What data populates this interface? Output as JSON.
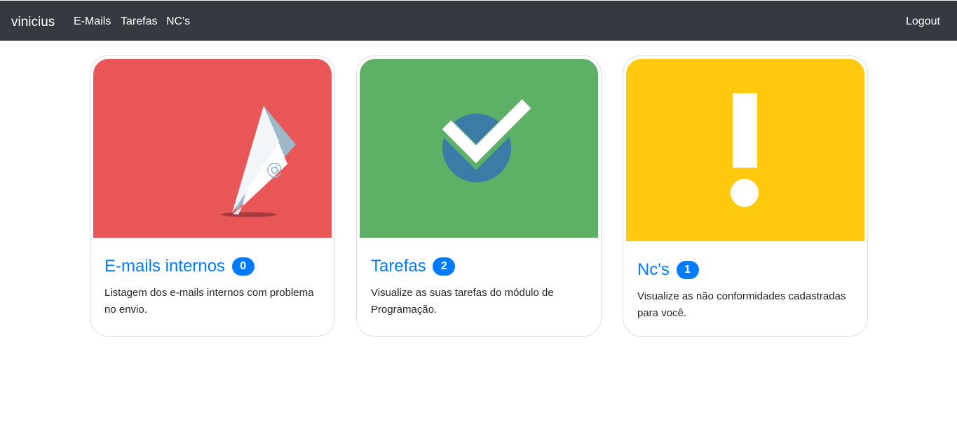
{
  "navbar": {
    "brand": "vinicius",
    "links": [
      "E-Mails",
      "Tarefas",
      "NC's"
    ],
    "logout": "Logout"
  },
  "cards": [
    {
      "icon": "paper-plane-email-icon",
      "bg_color": "#e95658",
      "title": "E-mails internos",
      "badge": "0",
      "text": "Listagem dos e-mails internos com problema no envio."
    },
    {
      "icon": "checkmark-icon",
      "bg_color": "#5db066",
      "title": "Tarefas",
      "badge": "2",
      "text": "Visualize as suas tarefas do módulo de Programação."
    },
    {
      "icon": "exclamation-icon",
      "bg_color": "#ffc90e",
      "title": "Nc's",
      "badge": "1",
      "text": "Visualize as não conformidades cadastradas para você."
    }
  ],
  "colors": {
    "navbar_bg": "#343a40",
    "link_blue": "#007bff",
    "badge_bg": "#007bff"
  }
}
